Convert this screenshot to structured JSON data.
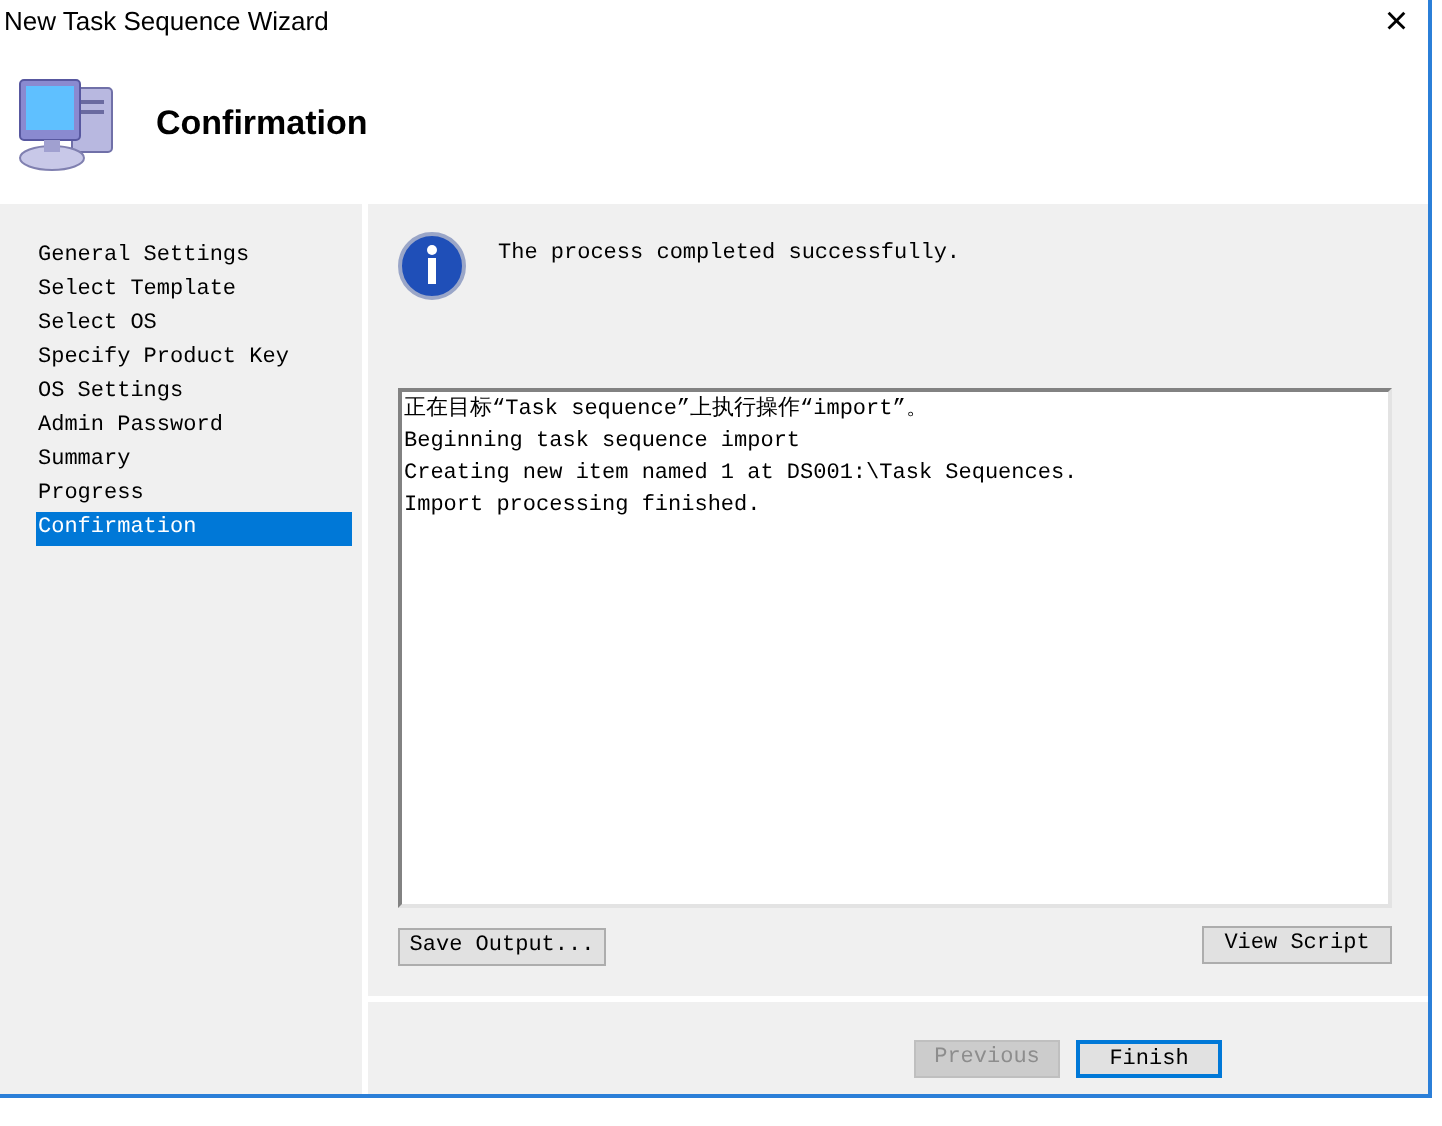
{
  "window": {
    "title": "New Task Sequence Wizard",
    "close": "×"
  },
  "header": {
    "title": "Confirmation"
  },
  "nav": [
    {
      "label": "General Settings",
      "selected": false
    },
    {
      "label": "Select Template",
      "selected": false
    },
    {
      "label": "Select OS",
      "selected": false
    },
    {
      "label": "Specify Product Key",
      "selected": false
    },
    {
      "label": "OS Settings",
      "selected": false
    },
    {
      "label": "Admin Password",
      "selected": false
    },
    {
      "label": "Summary",
      "selected": false
    },
    {
      "label": "Progress",
      "selected": false
    },
    {
      "label": "Confirmation",
      "selected": true
    }
  ],
  "status": {
    "message": "The process completed successfully."
  },
  "output": {
    "lines": [
      "正在目标“Task sequence”上执行操作“import”。",
      "Beginning task sequence import",
      "Creating new item named 1 at DS001:\\Task Sequences.",
      "Import processing finished."
    ]
  },
  "buttons": {
    "save_output": {
      "label": "Save Output...",
      "disabled": false
    },
    "view_script": {
      "label": "View Script",
      "disabled": false
    },
    "previous": {
      "label": "Previous",
      "disabled": true
    },
    "finish": {
      "label": "Finish",
      "disabled": false
    }
  }
}
